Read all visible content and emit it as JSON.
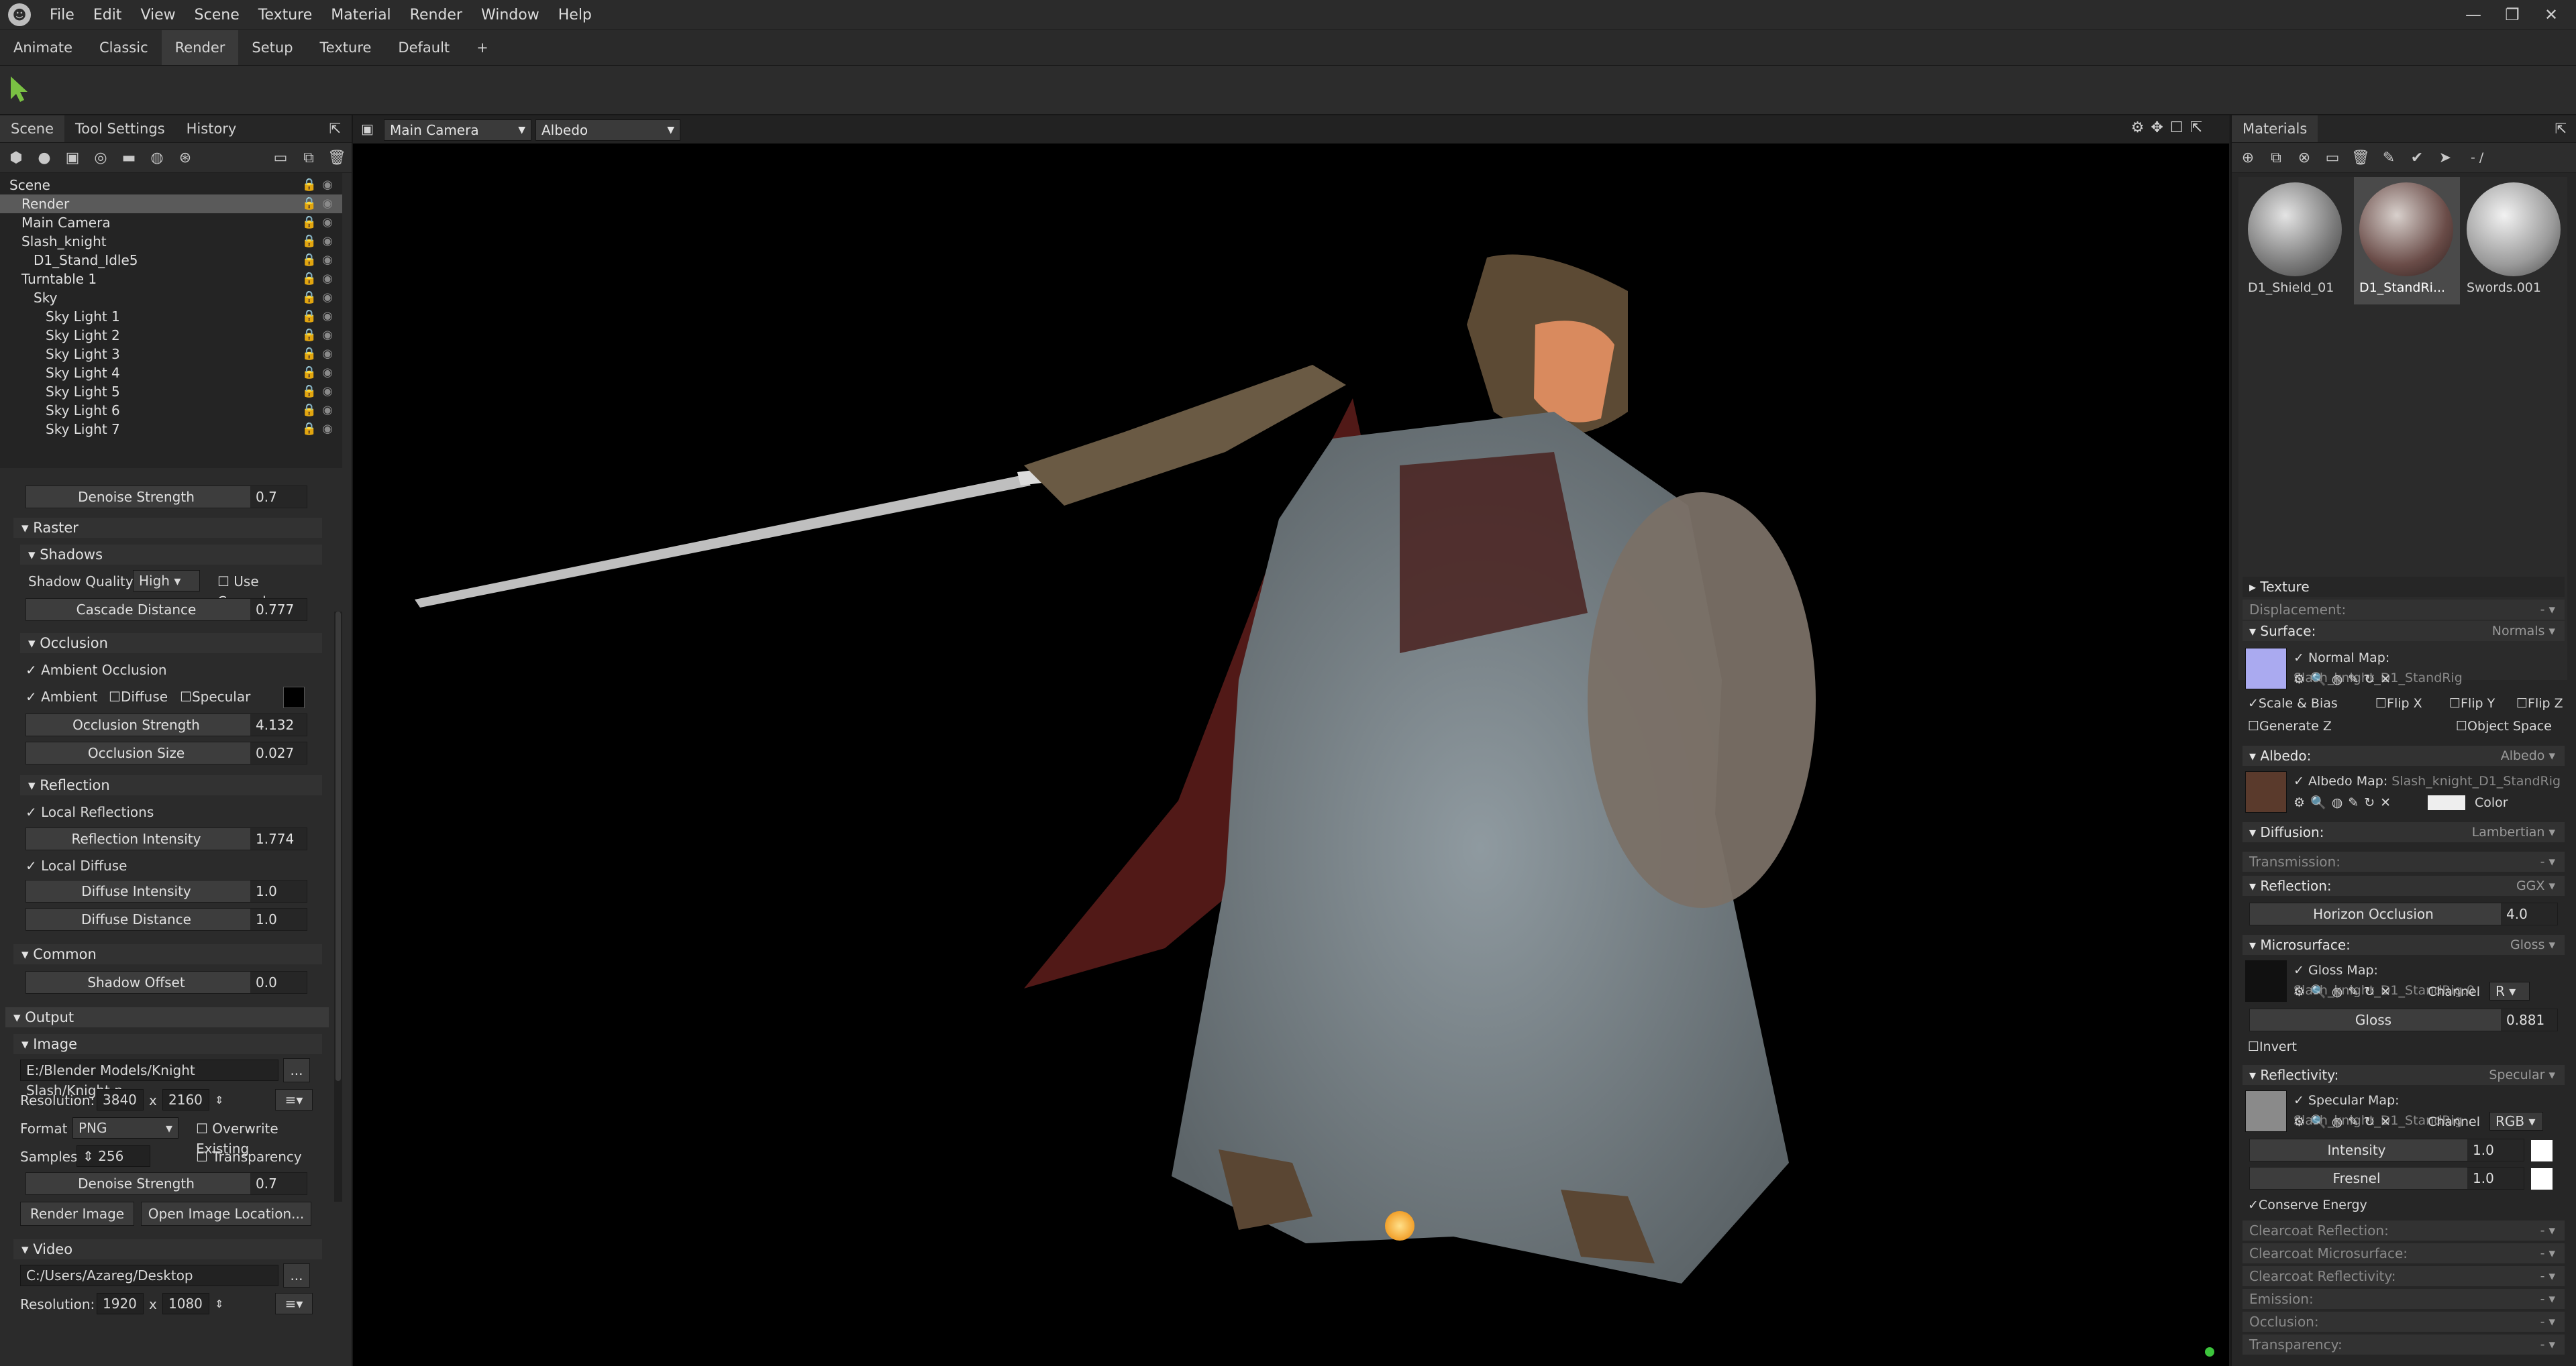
{
  "app": {
    "menu": [
      "File",
      "Edit",
      "View",
      "Scene",
      "Texture",
      "Material",
      "Render",
      "Window",
      "Help"
    ],
    "window_controls": [
      "—",
      "❐",
      "✕"
    ]
  },
  "layout_tabs": {
    "tabs": [
      "Animate",
      "Classic",
      "Render",
      "Setup",
      "Texture",
      "Default"
    ],
    "active": "Render",
    "add": "+"
  },
  "left": {
    "tabs": [
      "Scene",
      "Tool Settings",
      "History"
    ],
    "tree": [
      {
        "label": "Scene",
        "indent": 0
      },
      {
        "label": "Render",
        "indent": 1,
        "selected": true
      },
      {
        "label": "Main Camera",
        "indent": 1
      },
      {
        "label": "Slash_knight",
        "indent": 1
      },
      {
        "label": "D1_Stand_Idle5",
        "indent": 2
      },
      {
        "label": "Turntable 1",
        "indent": 1
      },
      {
        "label": "Sky",
        "indent": 2
      },
      {
        "label": "Sky Light 1",
        "indent": 3
      },
      {
        "label": "Sky Light 2",
        "indent": 3
      },
      {
        "label": "Sky Light 3",
        "indent": 3
      },
      {
        "label": "Sky Light 4",
        "indent": 3
      },
      {
        "label": "Sky Light 5",
        "indent": 3
      },
      {
        "label": "Sky Light 6",
        "indent": 3
      },
      {
        "label": "Sky Light 7",
        "indent": 3
      }
    ],
    "props": {
      "denoise_label": "Denoise Strength",
      "denoise_val": "0.7",
      "raster": "Raster",
      "shadows": "Shadows",
      "shadow_quality": "Shadow Quality",
      "shadow_quality_val": "High",
      "use_cascades": "Use Cascades",
      "cascade_distance": "Cascade Distance",
      "cascade_distance_val": "0.777",
      "occlusion": "Occlusion",
      "ambient_occlusion": "Ambient Occlusion",
      "ambient": "Ambient",
      "diffuse": "Diffuse",
      "specular": "Specular",
      "occlusion_strength": "Occlusion Strength",
      "occlusion_strength_val": "4.132",
      "occlusion_size": "Occlusion Size",
      "occlusion_size_val": "0.027",
      "reflection": "Reflection",
      "local_reflections": "Local Reflections",
      "reflection_intensity": "Reflection Intensity",
      "reflection_intensity_val": "1.774",
      "local_diffuse": "Local Diffuse",
      "diffuse_intensity": "Diffuse Intensity",
      "diffuse_intensity_val": "1.0",
      "diffuse_distance": "Diffuse Distance",
      "diffuse_distance_val": "1.0",
      "common": "Common",
      "shadow_offset": "Shadow Offset",
      "shadow_offset_val": "0.0",
      "output": "Output",
      "image": "Image",
      "image_path": "E:/Blender Models/Knight Slash/Knight.p",
      "browse": "...",
      "resolution": "Resolution:",
      "res_w": "3840",
      "x": "x",
      "res_h": "2160",
      "format": "Format",
      "format_val": "PNG",
      "overwrite": "Overwrite Existing",
      "samples": "Samples",
      "samples_val": "256",
      "transparency": "Transparency",
      "denoise2_label": "Denoise Strength",
      "denoise2_val": "0.7",
      "render_image": "Render Image",
      "open_location": "Open Image Location...",
      "video": "Video",
      "video_path": "C:/Users/Azareg/Desktop",
      "vres_w": "1920",
      "vres_h": "1080"
    }
  },
  "viewport": {
    "camera": "Main Camera",
    "channel": "Albedo"
  },
  "right": {
    "title": "Materials",
    "materials": [
      {
        "name": "D1_Shield_01",
        "selected": false
      },
      {
        "name": "D1_StandRi...",
        "selected": true
      },
      {
        "name": "Swords.001",
        "selected": false
      }
    ],
    "page": "- /",
    "texture": "Texture",
    "displacement": "Displacement:",
    "displacement_val": "-",
    "surface": "Surface:",
    "surface_val": "Normals",
    "normal_map": "Normal Map:",
    "normal_map_val": "Slash_knight_D1_StandRig",
    "scale_bias": "Scale & Bias",
    "flip_x": "Flip X",
    "flip_y": "Flip Y",
    "flip_z": "Flip Z",
    "generate_z": "Generate Z",
    "object_space": "Object Space",
    "albedo": "Albedo:",
    "albedo_val": "Albedo",
    "albedo_map": "Albedo Map:",
    "albedo_map_val": "Slash_knight_D1_StandRig",
    "color": "Color",
    "diffusion": "Diffusion:",
    "diffusion_val": "Lambertian",
    "transmission": "Transmission:",
    "transmission_val": "-",
    "reflection": "Reflection:",
    "reflection_val": "GGX",
    "horizon_occlusion": "Horizon Occlusion",
    "horizon_occlusion_val": "4.0",
    "microsurface": "Microsurface:",
    "microsurface_val": "Gloss",
    "gloss_map": "Gloss Map:",
    "gloss_map_val": "Slash_knight_D1_StandRig.0",
    "channel": "Channel",
    "gloss_channel": "R",
    "gloss": "Gloss",
    "gloss_val": "0.881",
    "invert": "Invert",
    "reflectivity": "Reflectivity:",
    "reflectivity_val": "Specular",
    "specular_map": "Specular Map:",
    "specular_map_val": "Slash_knight_D1_StandRig",
    "spec_channel": "RGB",
    "intensity": "Intensity",
    "intensity_val": "1.0",
    "fresnel": "Fresnel",
    "fresnel_val": "1.0",
    "conserve_energy": "Conserve Energy",
    "clearcoat_reflection": "Clearcoat Reflection:",
    "clearcoat_microsurface": "Clearcoat Microsurface:",
    "clearcoat_reflectivity": "Clearcoat Reflectivity:",
    "emission": "Emission:",
    "occlusion": "Occlusion:",
    "transparency": "Transparency:",
    "dash": "-"
  },
  "colors": {
    "accent_green": "#7ac143",
    "light_sun": "#ffb845",
    "status_dot": "#3cc43c"
  }
}
